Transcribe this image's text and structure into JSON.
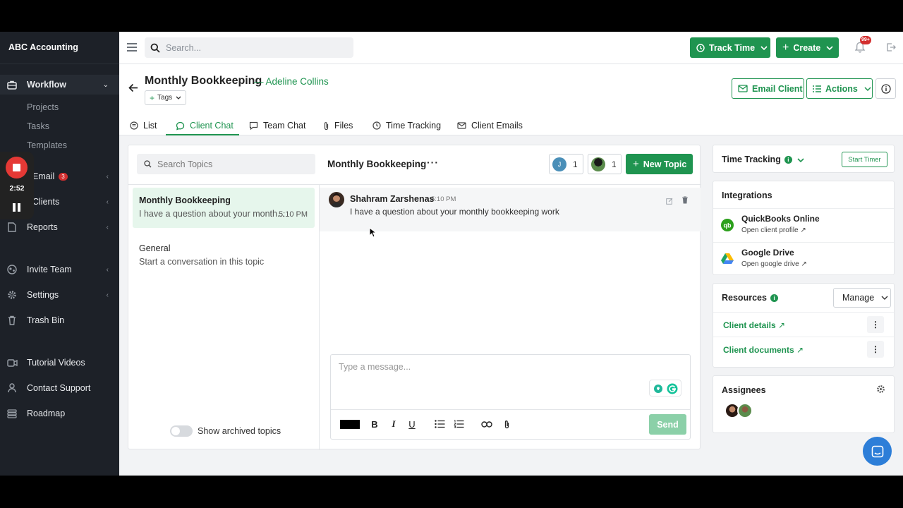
{
  "app": {
    "brand": "ABC Accounting"
  },
  "sidebar": {
    "workflow": "Workflow",
    "sub_items": [
      "Projects",
      "Tasks",
      "Templates"
    ],
    "email": "Email",
    "email_badge": "3",
    "clients": "Clients",
    "reports": "Reports",
    "invite_team": "Invite Team",
    "settings": "Settings",
    "trash_bin": "Trash Bin",
    "tutorial_videos": "Tutorial Videos",
    "contact_support": "Contact Support",
    "roadmap": "Roadmap"
  },
  "recorder": {
    "time": "2:52"
  },
  "topbar": {
    "search_placeholder": "Search...",
    "track_time": "Track Time",
    "create": "Create",
    "notif_count": "99+"
  },
  "header": {
    "title": "Monthly Bookkeeping",
    "client": "— Adeline Collins",
    "tags": "Tags",
    "email_client": "Email Client",
    "actions": "Actions"
  },
  "tabs": [
    {
      "label": "List"
    },
    {
      "label": "Client Chat"
    },
    {
      "label": "Team Chat"
    },
    {
      "label": "Files"
    },
    {
      "label": "Time Tracking"
    },
    {
      "label": "Client Emails"
    }
  ],
  "chat": {
    "search_placeholder": "Search Topics",
    "topics": [
      {
        "title": "Monthly Bookkeeping",
        "preview": "I have a question about your month...",
        "time": "5:10 PM"
      },
      {
        "title": "General",
        "preview": "Start a conversation in this topic",
        "time": ""
      }
    ],
    "show_archived": "Show archived topics",
    "channel_title": "Monthly Bookkeeping",
    "participants": [
      {
        "initial": "J",
        "count": "1"
      },
      {
        "initial": "",
        "count": "1"
      }
    ],
    "new_topic": "New Topic",
    "messages": [
      {
        "author": "Shahram Zarshenas",
        "time": "5:10 PM",
        "text": "I have a question about your monthly bookkeeping work"
      }
    ],
    "composer_placeholder": "Type a message...",
    "send": "Send"
  },
  "right": {
    "time_tracking": "Time Tracking",
    "start_timer": "Start Timer",
    "integrations": "Integrations",
    "integration_items": [
      {
        "name": "QuickBooks Online",
        "link": "Open client profile"
      },
      {
        "name": "Google Drive",
        "link": "Open google drive"
      }
    ],
    "resources": "Resources",
    "manage": "Manage",
    "resource_items": [
      "Client details",
      "Client documents"
    ],
    "assignees": "Assignees"
  },
  "colors": {
    "accent": "#1f9450",
    "sidebar": "#1d2128",
    "danger": "#d32f2f",
    "intercom": "#2d7ed8"
  }
}
